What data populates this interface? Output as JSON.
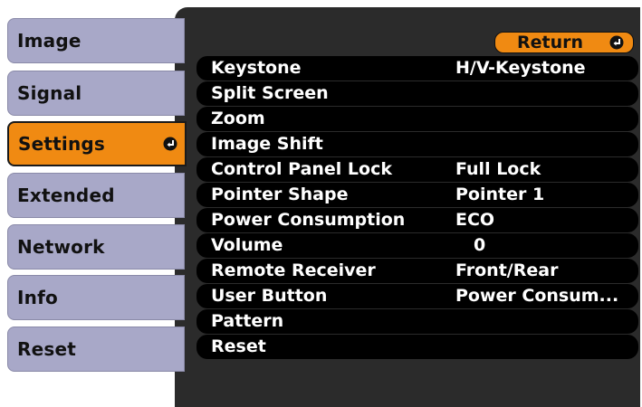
{
  "sidebar": {
    "items": [
      {
        "label": "Image"
      },
      {
        "label": "Signal"
      },
      {
        "label": "Settings"
      },
      {
        "label": "Extended"
      },
      {
        "label": "Network"
      },
      {
        "label": "Info"
      },
      {
        "label": "Reset"
      }
    ],
    "active_index": 2
  },
  "return_button": {
    "label": "Return"
  },
  "settings": {
    "rows": [
      {
        "label": "Keystone",
        "value": "H/V-Keystone"
      },
      {
        "label": "Split Screen",
        "value": ""
      },
      {
        "label": "Zoom",
        "value": ""
      },
      {
        "label": "Image Shift",
        "value": ""
      },
      {
        "label": "Control Panel Lock",
        "value": "Full Lock"
      },
      {
        "label": "Pointer Shape",
        "value": "Pointer 1"
      },
      {
        "label": "Power Consumption",
        "value": "ECO"
      },
      {
        "label": "Volume",
        "value": "0"
      },
      {
        "label": "Remote Receiver",
        "value": "Front/Rear"
      },
      {
        "label": "User Button",
        "value": "Power Consum..."
      },
      {
        "label": "Pattern",
        "value": ""
      },
      {
        "label": "Reset",
        "value": ""
      }
    ]
  },
  "icons": {
    "enter": "enter-icon"
  },
  "colors": {
    "accent": "#f08a12",
    "tab": "#a8a8c8",
    "panel": "#2b2b2b",
    "row": "#000000",
    "text_light": "#ffffff"
  }
}
